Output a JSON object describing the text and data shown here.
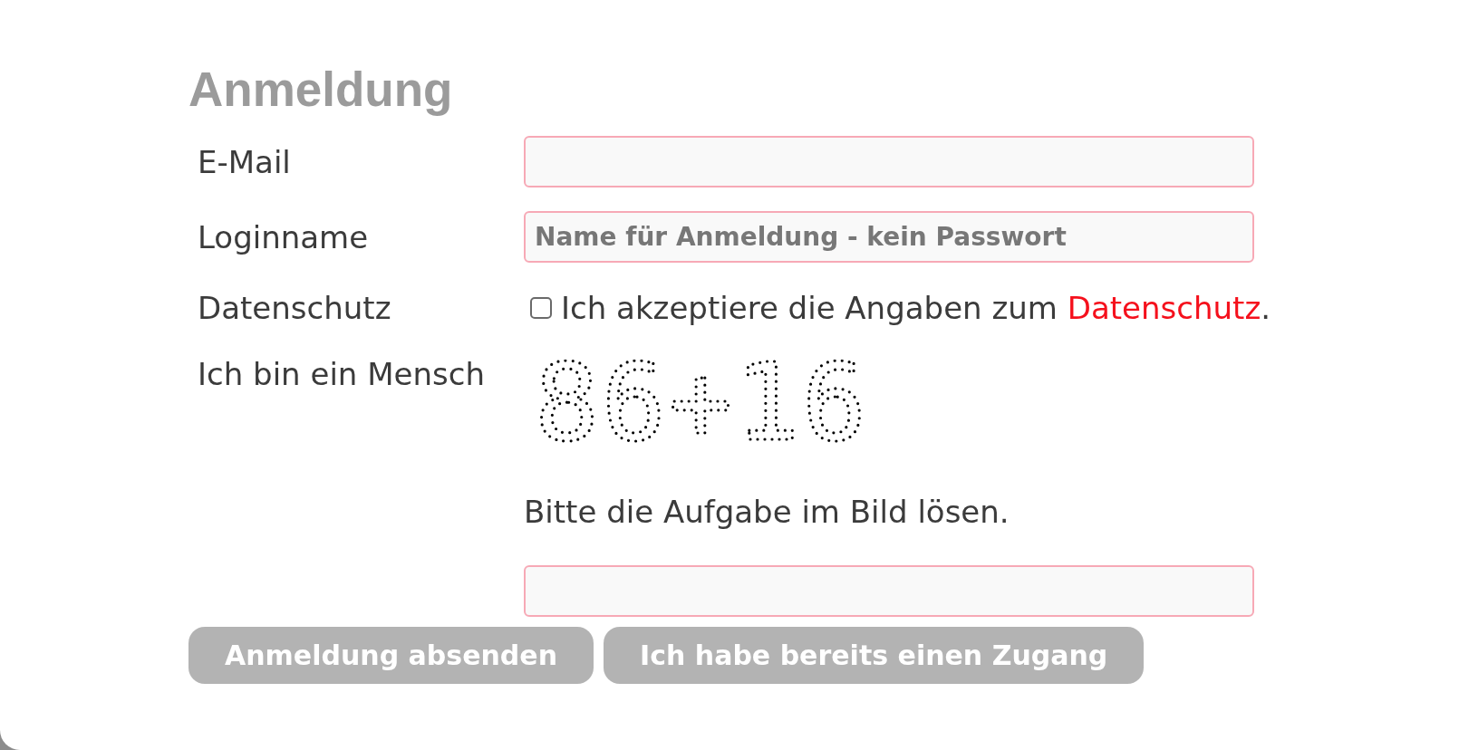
{
  "title": "Anmeldung",
  "fields": [
    {
      "kind": "input",
      "label": "E-Mail"
    },
    {
      "kind": "input",
      "label": "Loginname",
      "placeholder": "Name für Anmeldung - kein Passwort"
    },
    {
      "kind": "checkbox",
      "label": "Datenschutz",
      "checked": false,
      "text": "Ich akzeptiere die Angaben zum ",
      "link": "Datenschutz",
      "text_after": "."
    },
    {
      "kind": "captcha",
      "label": "Ich bin ein Mensch",
      "captcha": "86+16",
      "hint": "Bitte die Aufgabe im Bild lösen."
    }
  ],
  "buttons": [
    {
      "label": "Anmeldung absenden"
    },
    {
      "label": "Ich habe bereits einen Zugang"
    }
  ]
}
